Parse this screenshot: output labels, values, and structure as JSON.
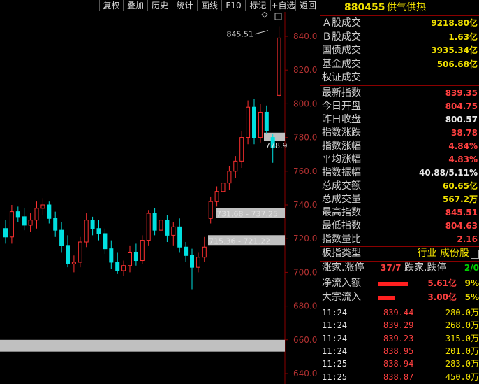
{
  "toolbar": {
    "buttons": [
      "复权",
      "叠加",
      "历史",
      "统计",
      "画线",
      "F10",
      "标记",
      "+自选",
      "返回"
    ]
  },
  "chart": {
    "y_ticks": [
      "840.0",
      "820.0",
      "800.0",
      "780.0",
      "760.0",
      "740.0",
      "720.0",
      "700.0",
      "680.0",
      "660.0",
      "640.0"
    ],
    "y_values": [
      840,
      820,
      800,
      780,
      760,
      740,
      720,
      700,
      680,
      660,
      640
    ],
    "high_label": "845.51",
    "price_tag": "778.9",
    "gap1_label": "731.68 - 737.25",
    "gap2_label": "715.36 - 721.22",
    "colors": {
      "up": "#ff3030",
      "down": "#00e0e0",
      "gap": "#c0c0c0",
      "grid": "#8b0000"
    }
  },
  "chart_data": {
    "type": "candlestick",
    "ylim": [
      636,
      848
    ],
    "candles": [
      {
        "o": 726,
        "h": 731,
        "l": 717,
        "c": 721
      },
      {
        "o": 721,
        "h": 740,
        "l": 717,
        "c": 736
      },
      {
        "o": 736,
        "h": 739,
        "l": 730,
        "c": 733
      },
      {
        "o": 733,
        "h": 738,
        "l": 725,
        "c": 728
      },
      {
        "o": 728,
        "h": 735,
        "l": 724,
        "c": 731
      },
      {
        "o": 731,
        "h": 742,
        "l": 726,
        "c": 738
      },
      {
        "o": 738,
        "h": 744,
        "l": 734,
        "c": 740
      },
      {
        "o": 740,
        "h": 742,
        "l": 729,
        "c": 732
      },
      {
        "o": 732,
        "h": 736,
        "l": 721,
        "c": 725
      },
      {
        "o": 725,
        "h": 730,
        "l": 712,
        "c": 716
      },
      {
        "o": 716,
        "h": 722,
        "l": 703,
        "c": 705
      },
      {
        "o": 705,
        "h": 710,
        "l": 700,
        "c": 706
      },
      {
        "o": 706,
        "h": 721,
        "l": 703,
        "c": 718
      },
      {
        "o": 718,
        "h": 735,
        "l": 715,
        "c": 731
      },
      {
        "o": 731,
        "h": 733,
        "l": 722,
        "c": 726
      },
      {
        "o": 726,
        "h": 731,
        "l": 719,
        "c": 723
      },
      {
        "o": 723,
        "h": 726,
        "l": 711,
        "c": 714
      },
      {
        "o": 714,
        "h": 719,
        "l": 702,
        "c": 706
      },
      {
        "o": 706,
        "h": 712,
        "l": 699,
        "c": 701
      },
      {
        "o": 701,
        "h": 707,
        "l": 698,
        "c": 704
      },
      {
        "o": 704,
        "h": 716,
        "l": 700,
        "c": 712
      },
      {
        "o": 712,
        "h": 717,
        "l": 704,
        "c": 707
      },
      {
        "o": 707,
        "h": 722,
        "l": 705,
        "c": 719
      },
      {
        "o": 719,
        "h": 737,
        "l": 716,
        "c": 735
      },
      {
        "o": 735,
        "h": 738,
        "l": 722,
        "c": 725
      },
      {
        "o": 725,
        "h": 736,
        "l": 721,
        "c": 731
      },
      {
        "o": 731,
        "h": 734,
        "l": 718,
        "c": 722
      },
      {
        "o": 722,
        "h": 730,
        "l": 716,
        "c": 727
      },
      {
        "o": 727,
        "h": 732,
        "l": 712,
        "c": 715
      },
      {
        "o": 715,
        "h": 718,
        "l": 706,
        "c": 710
      },
      {
        "o": 710,
        "h": 714,
        "l": 690,
        "c": 703
      },
      {
        "o": 703,
        "h": 712,
        "l": 700,
        "c": 709
      },
      {
        "o": 709,
        "h": 721,
        "l": 706,
        "c": 715
      },
      {
        "o": 732,
        "h": 745,
        "l": 729,
        "c": 742
      },
      {
        "o": 742,
        "h": 751,
        "l": 739,
        "c": 748
      },
      {
        "o": 748,
        "h": 756,
        "l": 745,
        "c": 753
      },
      {
        "o": 753,
        "h": 763,
        "l": 749,
        "c": 760
      },
      {
        "o": 760,
        "h": 769,
        "l": 756,
        "c": 766
      },
      {
        "o": 766,
        "h": 784,
        "l": 762,
        "c": 780
      },
      {
        "o": 780,
        "h": 802,
        "l": 776,
        "c": 798
      },
      {
        "o": 798,
        "h": 803,
        "l": 776,
        "c": 780
      },
      {
        "o": 780,
        "h": 800,
        "l": 777,
        "c": 795
      },
      {
        "o": 795,
        "h": 799,
        "l": 782,
        "c": 784
      },
      {
        "o": 780,
        "h": 782,
        "l": 765,
        "c": 774
      },
      {
        "o": 805,
        "h": 846,
        "l": 804,
        "c": 839
      }
    ],
    "gaps": [
      [
        731.68,
        737.25
      ],
      [
        715.36,
        721.22
      ]
    ],
    "extra_band": [
      657,
      660
    ]
  },
  "panel": {
    "code": "880455",
    "name": "供气供热",
    "volume_rows": [
      {
        "label": "Ａ股成交",
        "value": "9218.80亿"
      },
      {
        "label": "Ｂ股成交",
        "value": "1.63亿"
      },
      {
        "label": "国债成交",
        "value": "3935.34亿"
      },
      {
        "label": "基金成交",
        "value": "506.68亿"
      },
      {
        "label": "权证成交",
        "value": ""
      }
    ],
    "index_rows": [
      {
        "label": "最新指数",
        "value": "839.35",
        "cls": "r"
      },
      {
        "label": "今日开盘",
        "value": "804.75",
        "cls": "r"
      },
      {
        "label": "昨日收盘",
        "value": "800.57",
        "cls": "w"
      },
      {
        "label": "指数涨跌",
        "value": "38.78",
        "cls": "r"
      },
      {
        "label": "指数涨幅",
        "value": "4.84%",
        "cls": "r"
      },
      {
        "label": "平均涨幅",
        "value": "4.83%",
        "cls": "r"
      },
      {
        "label": "指数振幅",
        "value": "40.88/5.11%",
        "cls": "w"
      },
      {
        "label": "总成交额",
        "value": "60.65亿",
        "cls": "y"
      },
      {
        "label": "总成交量",
        "value": "567.2万",
        "cls": "y"
      },
      {
        "label": "最高指数",
        "value": "845.51",
        "cls": "r"
      },
      {
        "label": "最低指数",
        "value": "804.63",
        "cls": "r"
      },
      {
        "label": "指数量比",
        "value": "2.16",
        "cls": "r"
      }
    ],
    "board_type": {
      "label": "板指类型",
      "value": "行业 成份股"
    },
    "updown": {
      "label1": "涨家.涨停",
      "value1": "37/7",
      "label2": "跌家.跌停",
      "value2": "2/0"
    },
    "flows": [
      {
        "label": "净流入额",
        "value": "5.61亿",
        "pct": "9%",
        "bar_fraction": 0.9
      },
      {
        "label": "大宗流入",
        "value": "3.00亿",
        "pct": "5%",
        "bar_fraction": 0.5
      }
    ],
    "ticks": [
      {
        "time": "11:24",
        "price": "839.44",
        "vol": "280.0万"
      },
      {
        "time": "11:24",
        "price": "839.29",
        "vol": "268.0万"
      },
      {
        "time": "11:24",
        "price": "839.23",
        "vol": "315.0万"
      },
      {
        "time": "11:24",
        "price": "838.95",
        "vol": "201.0万"
      },
      {
        "time": "11:25",
        "price": "838.94",
        "vol": "283.0万"
      },
      {
        "time": "11:25",
        "price": "838.87",
        "vol": "450.0万"
      }
    ]
  }
}
